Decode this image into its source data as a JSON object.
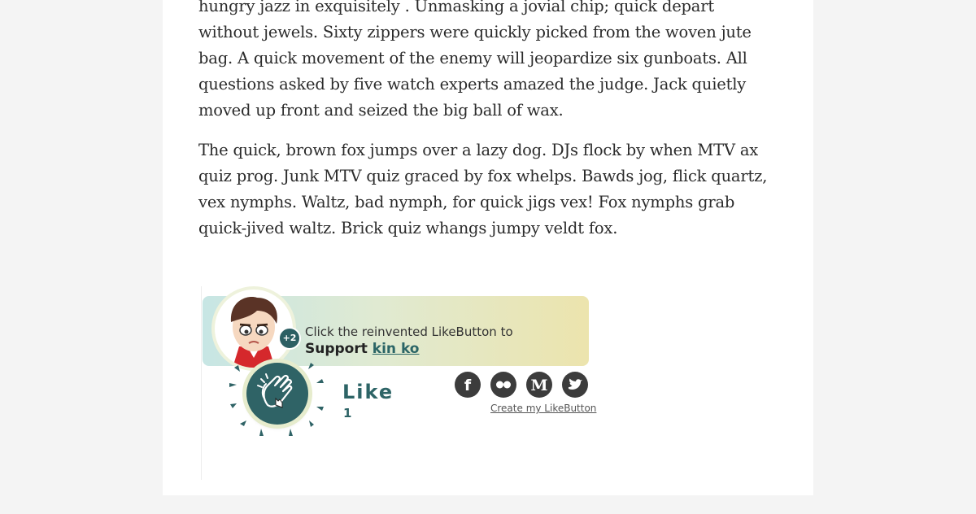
{
  "article": {
    "paragraph1": "hungry jazz in exquisitely . Unmasking a jovial chip; quick depart without jewels. Sixty zippers were quickly picked from the woven jute bag. A quick movement of the enemy will jeopardize six gunboats. All questions asked by five watch experts amazed the judge. Jack quietly moved up front and seized the big ball of wax.",
    "paragraph2": "The quick, brown fox jumps over a lazy dog. DJs flock by when MTV ax quiz prog. Junk MTV quiz graced by fox whelps. Bawds jog, flick quartz, vex nymphs. Waltz, bad nymph, for quick jigs vex! Fox nymphs grab quick-jived waltz. Brick quiz whangs jumpy veldt fox."
  },
  "likebutton": {
    "prompt": "Click the reinvented LikeButton to",
    "support_label": "Support",
    "creator_name": "kin ko",
    "supporters_badge": "+2",
    "like_label": "Like",
    "like_count": "1",
    "create_link": "Create my LikeButton",
    "social_icons": [
      "facebook-icon",
      "flickr-icon",
      "medium-icon",
      "twitter-icon"
    ]
  },
  "colors": {
    "page_bg": "#f4f4f4",
    "card_bg": "#ffffff",
    "accent": "#2f6366",
    "social_bg": "#3c3c3c"
  }
}
